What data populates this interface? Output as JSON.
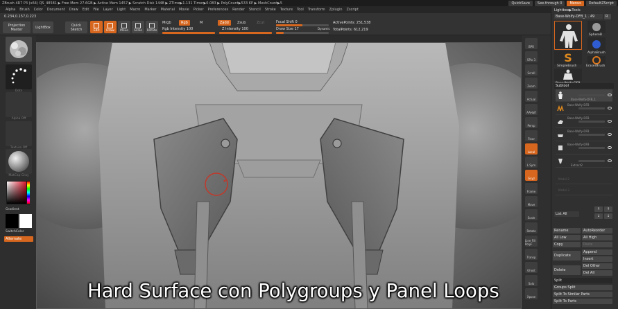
{
  "titlebar": {
    "text": "ZBrush 4R7 P3 (x64)    QS_48581    ▶ Free Mem 27.6GB ▶ Active Mem 1457 ▶ Scratch Disk 1448 ▶ ZTime▶1.131 Timer▶0.083 ▶ PolyCount▶533 KP ▶ MeshCount▶5",
    "quicksave": "QuickSave",
    "seethrough": "See-through  0",
    "menus": "Menus",
    "script": "DefaultZScript"
  },
  "menubar": [
    "Alpha",
    "Brush",
    "Color",
    "Document",
    "Draw",
    "Edit",
    "File",
    "Layer",
    "Light",
    "Macro",
    "Marker",
    "Material",
    "Movie",
    "Picker",
    "Preferences",
    "Render",
    "Stencil",
    "Stroke",
    "Texture",
    "Tool",
    "Transform",
    "Zplugin",
    "Zscript"
  ],
  "shelf": {
    "coords": "0.234,0.157,0.223",
    "projection_master": "Projection Master",
    "lightbox": "LightBox",
    "quick_sketch": "Quick Sketch",
    "modes": [
      "Edit",
      "Draw",
      "Move",
      "Scale",
      "Rotate"
    ],
    "mrgb": "Mrgb",
    "rgb": "Rgb",
    "m": "M",
    "rgb_intensity": "Rgb Intensity 100",
    "rgb_intensity_value": 100,
    "zadd": "Zadd",
    "zsub": "Zsub",
    "zcut": "Zcut",
    "z_intensity": "Z Intensity 100",
    "z_intensity_value": 100,
    "focal_shift": "Focal Shift 0",
    "draw_size": "Draw Size 17",
    "dynamic": "Dynamic",
    "active_points": "ActivePoints: 251,538",
    "total_points": "TotalPoints: 612,219"
  },
  "lefttray": {
    "dots": "Dots",
    "alpha_off": "Alpha Off",
    "texture_off": "Texture Off",
    "matcap": "MatCap Gray",
    "gradient": "Gradient",
    "switchcolor": "SwitchColor",
    "alternate": "Alternate"
  },
  "righttools": [
    "BPR",
    "SPix 3",
    "Scroll",
    "Zoom",
    "Actual",
    "AAHalf",
    "Persp",
    "Floor",
    "Local",
    "L.Sym",
    "Gxyz",
    "Frame",
    "Move",
    "Scale",
    "Rotate",
    "Line Fill PolyF",
    "Transp",
    "Ghost",
    "Solo",
    "Xpose"
  ],
  "palette": {
    "lightbox_tools": "Lightbox▶Tools",
    "tool_name": "Base-Wolfy-DFB_1 . 49",
    "tool_count": "R",
    "tools": [
      "Base-Wolfy-DFB_1",
      "SphereB",
      "AlphaBrush",
      "SimpleBrush",
      "EraserBrush",
      "Base-Wolfy-DFB"
    ],
    "subtool": "Subtool",
    "subtools": [
      "Base-Wolfy-DFB_1",
      "Base-Wolfy-DFB",
      "Base-Wolfy-DFB",
      "Base-Wolfy-DFB",
      "Base-Wolfy-DFB",
      "Extract2",
      "Model 2",
      "Model 3"
    ],
    "list_all": "List All",
    "rename": "Rename",
    "auto_reorder": "AutoReorder",
    "all_low": "All Low",
    "all_high": "All High",
    "copy": "Copy",
    "paste": "Paste",
    "duplicate": "Duplicate",
    "append": "Append",
    "insert": "Insert",
    "delete": "Delete",
    "del_other": "Del Other",
    "del_all": "Del All",
    "split": "Split",
    "groups_split": "Groups Split",
    "split_unmasked": "Split To Similar Parts",
    "split_parts": "Split To Parts"
  },
  "caption": "Hard Surface con Polygroups y Panel Loops",
  "colors": {
    "accent": "#d7671f",
    "panel": "#303030",
    "viewport_center": "#9a9a9a",
    "brush_ring": "#c0392b"
  }
}
